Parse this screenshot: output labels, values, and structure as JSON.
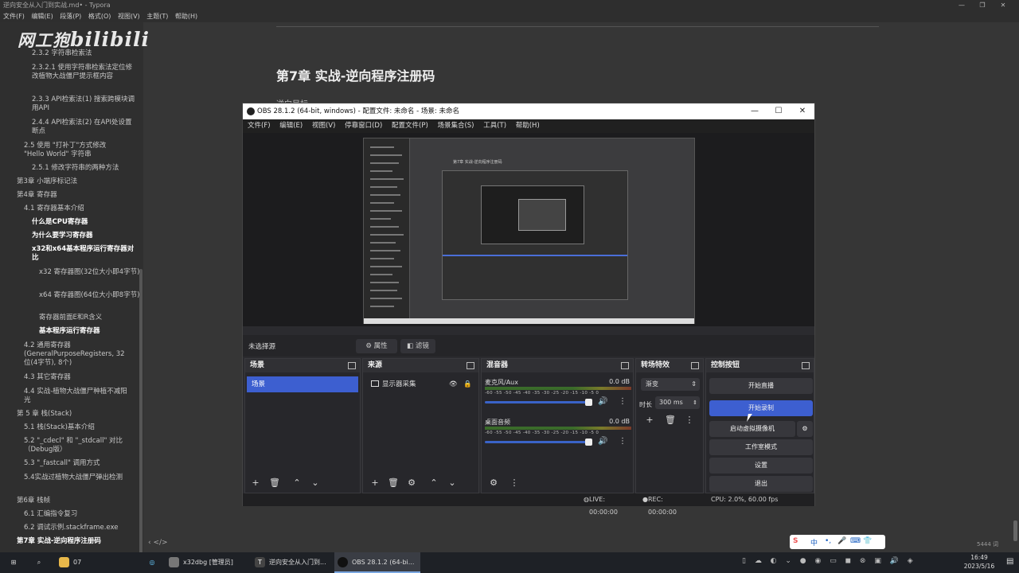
{
  "typora": {
    "title": "逆向安全从入门到实战.md• - Typora",
    "menu": [
      "文件(F)",
      "编辑(E)",
      "段落(P)",
      "格式(O)",
      "视图(V)",
      "主题(T)",
      "帮助(H)"
    ],
    "logo_text": "网工狍",
    "logo_brand": "bilibili",
    "doc_heading": "第7章 实战-逆向程序注册码",
    "doc_sub": "逆向目标",
    "word_count": "5444 词",
    "sidebar_bottom": "‹  </>",
    "outline": [
      "2.3.2 字符串检索法",
      "2.3.2.1 使用字符串检索法定位修改植物大战僵尸提示框内容",
      "2.3.3 API检索法(1) 搜索跨模块调用API",
      "2.4.4 API检索法(2) 在API处设置断点",
      "2.5 使用 \"打补丁\"方式修改 \"Hello World\" 字符串",
      "2.5.1 修改字符串的两种方法",
      "第3章 小端序标记法",
      "第4章 寄存器",
      "4.1 寄存器基本介绍",
      "什么是CPU寄存器",
      "为什么要学习寄存器",
      "x32和x64基本程序运行寄存器对比",
      "x32 寄存器图(32位大小即4字节)",
      "x64 寄存器图(64位大小即8字节)",
      "寄存器前面E和R含义",
      "基本程序运行寄存器",
      "4.2 通用寄存器(GeneralPurposeRegisters, 32位(4字节), 8个)",
      "4.3 其它寄存器",
      "4.4 实战-植物大战僵尸种植不减阳光",
      "第 5 章 栈(Stack)",
      "5.1 栈(Stack)基本介绍",
      "5.2 \"_cdecl\" 和 \"_stdcall\" 对比（Debug版）",
      "5.3 \"_fastcall\" 调用方式",
      "5.4实战过植物大战僵尸弹出检测",
      "第6章 栈帧",
      "6.1 汇编指令复习",
      "6.2 调试示例.stackframe.exe",
      "第7章 实战-逆向程序注册码"
    ]
  },
  "obs": {
    "title": "OBS 28.1.2 (64-bit, windows) - 配置文件: 未命名 - 场景: 未命名",
    "menu": [
      "文件(F)",
      "编辑(E)",
      "视图(V)",
      "停靠窗口(D)",
      "配置文件(P)",
      "场景集合(S)",
      "工具(T)",
      "帮助(H)"
    ],
    "preview_inner_title": "第7章 实战-逆向程序注册码",
    "no_source": "未选择源",
    "properties": "属性",
    "filters": "滤镜",
    "scenes": {
      "header": "场景",
      "items": [
        "场景"
      ]
    },
    "sources": {
      "header": "来源",
      "items": [
        "显示器采集"
      ]
    },
    "mixer": {
      "header": "混音器",
      "channels": [
        {
          "name": "麦克风/Aux",
          "db": "0.0 dB"
        },
        {
          "name": "桌面音频",
          "db": "0.0 dB"
        }
      ],
      "ticks": "-60 -55 -50 -45 -40 -35 -30 -25 -20 -15 -10 -5 0"
    },
    "transitions": {
      "header": "转场特效",
      "type": "渐变",
      "duration_label": "时长",
      "duration": "300 ms"
    },
    "controls": {
      "header": "控制按钮",
      "start_stream": "开始直播",
      "start_record": "开始录制",
      "virtual_cam": "启动虚拟摄像机",
      "studio_mode": "工作室模式",
      "settings": "设置",
      "exit": "退出"
    },
    "status": {
      "live": "LIVE: 00:00:00",
      "rec": "REC: 00:00:00",
      "cpu": "CPU: 2.0%, 60.00 fps"
    }
  },
  "taskbar": {
    "search_item": "07",
    "tasks": [
      "x32dbg [管理员]",
      "逆向安全从入门到...",
      "OBS 28.1.2 (64-bi..."
    ],
    "time": "16:49",
    "date": "2023/5/16",
    "ime": "中"
  },
  "colors": {
    "accent": "#3d5fd0",
    "obs_bg": "#2b2b2f",
    "typora_bg": "#363636"
  }
}
